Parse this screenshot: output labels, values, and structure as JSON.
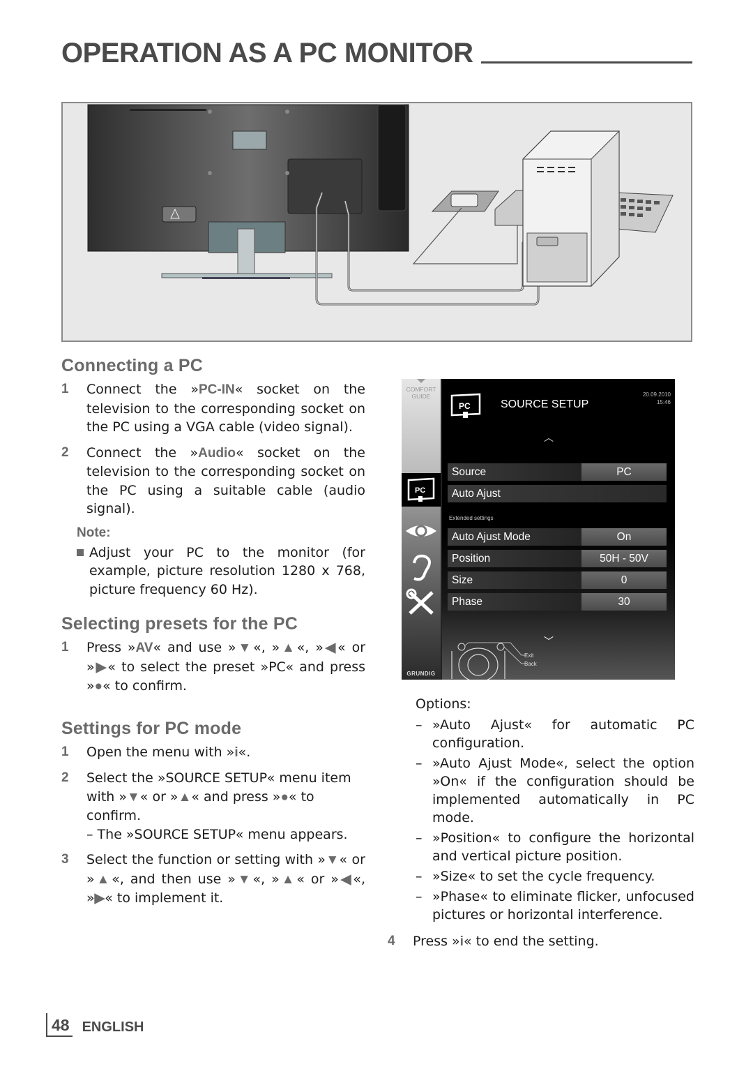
{
  "header": {
    "title": "OPERATION AS A PC MONITOR"
  },
  "figure": {
    "description": "TV rear panel connected to PC via VGA and audio cable",
    "icons": [
      "tv-rear-illustration",
      "pc-tower-illustration",
      "keyboard-illustration",
      "mouse-illustration"
    ]
  },
  "connecting": {
    "heading": "Connecting a PC",
    "steps": [
      {
        "num": "1",
        "pre": "Connect the »",
        "key": "PC-IN",
        "post": "« socket on the television to the corresponding socket on the PC using a VGA cable (video signal)."
      },
      {
        "num": "2",
        "pre": "Connect the »",
        "key": "Audio",
        "post": "« socket on the television to the corresponding socket on the PC using a suitable cable (audio signal)."
      }
    ],
    "note_label": "Note:",
    "note_text": "Adjust your PC to the monitor (for example, picture resolution 1280 x 768, picture frequency 60 Hz)."
  },
  "presets": {
    "heading": "Selecting presets for the PC",
    "steps": [
      {
        "num": "1",
        "text_a": "Press »",
        "key_av": "AV",
        "text_b": "« and use »",
        "down": "▼",
        "text_c": "«, »",
        "up": "▲",
        "text_d": "«, »",
        "left": "◀",
        "text_e": "« or »",
        "right": "▶",
        "text_f": "« to select the preset »PC« and press »",
        "ok": "●",
        "text_g": "« to confirm."
      }
    ]
  },
  "settings": {
    "heading": "Settings for PC mode",
    "steps": [
      {
        "num": "1",
        "text_a": "Open the menu with »",
        "key": "i",
        "text_b": "«."
      },
      {
        "num": "2",
        "text_a": "Select the »SOURCE SETUP« menu item with »",
        "down": "▼",
        "text_b": "« or »",
        "up": "▲",
        "text_c": "« and press »",
        "ok": "●",
        "text_d": "« to confirm.",
        "sub": "– The »SOURCE SETUP« menu appears."
      },
      {
        "num": "3",
        "text_a": "Select the function or setting with »",
        "down": "▼",
        "text_b": "« or »",
        "up": "▲",
        "text_c": "«, and then use »",
        "down2": "▼",
        "text_d": "«, »",
        "up2": "▲",
        "text_e": "« or »",
        "left": "◀",
        "text_f": "«, »",
        "right": "▶",
        "text_g": "« to implement it."
      }
    ]
  },
  "tv_menu": {
    "comfort_guide": "COMFORT\nGUIDE",
    "title": "SOURCE SETUP",
    "date": "20.09.2010",
    "time": "15:46",
    "extended_label": "Extended settings",
    "rows": [
      {
        "label": "Source",
        "value": "PC"
      },
      {
        "label": "Auto Ajust",
        "value": ""
      },
      {
        "label": "Auto Ajust Mode",
        "value": "On"
      },
      {
        "label": "Position",
        "value": "50H - 50V"
      },
      {
        "label": "Size",
        "value": "0"
      },
      {
        "label": "Phase",
        "value": "30"
      }
    ],
    "exit_label": "Exit",
    "back_label": "Back",
    "brand": "GRUNDIG",
    "side_icons": [
      "pc-source-icon",
      "eye-picture-icon",
      "ear-sound-icon",
      "tools-settings-icon"
    ]
  },
  "options": {
    "label": "Options:",
    "items": [
      "»Auto Ajust« for automatic PC configuration.",
      "»Auto Ajust Mode«, select the option »On« if the configuration should be implemented automatically in PC mode.",
      "»Position« to configure the horizontal and vertical picture position.",
      "»Size« to set the cycle frequency.",
      "»Phase« to eliminate flicker, unfocused pictures or horizontal interference."
    ],
    "dash": "–",
    "final_step": {
      "num": "4",
      "text_a": "Press »",
      "key": "i",
      "text_b": "« to end the setting."
    }
  },
  "footer": {
    "page_number": "48",
    "language": "ENGLISH"
  }
}
